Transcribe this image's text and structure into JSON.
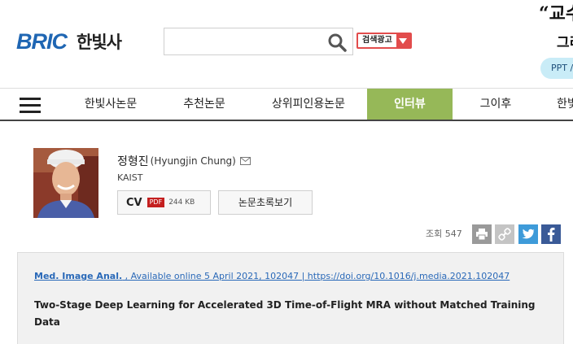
{
  "header": {
    "logo_brand": "BRIC",
    "logo_sub": "한빛사",
    "search": {
      "value": "",
      "placeholder": ""
    },
    "ad_label": "검색광고",
    "promo": {
      "line1": "“교수",
      "line2": "그리",
      "pill": "PPT / "
    }
  },
  "nav": {
    "items": [
      {
        "label": "한빛사논문"
      },
      {
        "label": "추천논문"
      },
      {
        "label": "상위피인용논문"
      },
      {
        "label": "인터뷰"
      },
      {
        "label": "그이후"
      },
      {
        "label": "한빛"
      }
    ],
    "active_index": 3,
    "active_color": "#96b858"
  },
  "profile": {
    "name_ko": "정형진",
    "name_en": "(Hyungjin Chung)",
    "affiliation": "KAIST",
    "cv": {
      "label": "CV",
      "file_type": "PDF",
      "size": "244 KB"
    },
    "abstract_button": "논문초록보기"
  },
  "stats": {
    "views_label": "조회 547"
  },
  "share_icons": [
    "print-icon",
    "link-icon",
    "twitter-icon",
    "facebook-icon"
  ],
  "paper": {
    "journal": "Med. Image Anal.",
    "citation_rest": " , Available online 5 April 2021, 102047 | https://doi.org/10.1016/j.media.2021.102047",
    "title": "Two-Stage Deep Learning for Accelerated 3D Time-of-Flight MRA without Matched Training Data"
  },
  "colors": {
    "brand_blue": "#1f66b3",
    "ad_red": "#e24c4c",
    "twitter": "#3e9bd9",
    "facebook": "#3a5a97"
  }
}
